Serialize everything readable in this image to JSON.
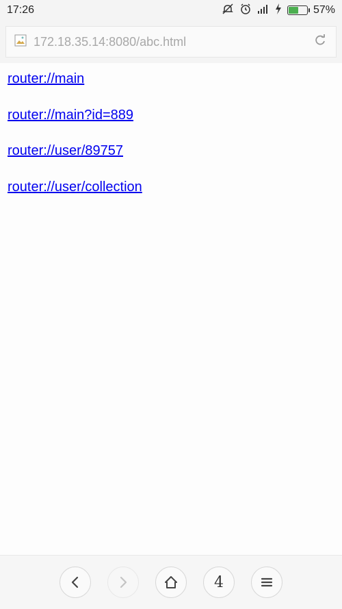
{
  "status_bar": {
    "time": "17:26",
    "battery_percent": "57%",
    "battery_level": 0.57,
    "icons": [
      "do-not-disturb-icon",
      "alarm-icon",
      "signal-icon",
      "charging-icon",
      "battery-icon"
    ]
  },
  "address_bar": {
    "url": "172.18.35.14:8080/abc.html",
    "favicon": "broken-image-icon",
    "reload": "reload-icon"
  },
  "content": {
    "links": [
      {
        "text": "router://main"
      },
      {
        "text": "router://main?id=889"
      },
      {
        "text": "router://user/89757"
      },
      {
        "text": "router://user/collection"
      }
    ]
  },
  "toolbar": {
    "back": "back-icon",
    "forward": "forward-icon",
    "home": "home-icon",
    "tab_count": "4",
    "menu": "menu-icon"
  },
  "colors": {
    "link": "#0000ee",
    "battery_fill": "#4caf50",
    "url_text": "#a8a8a8"
  }
}
